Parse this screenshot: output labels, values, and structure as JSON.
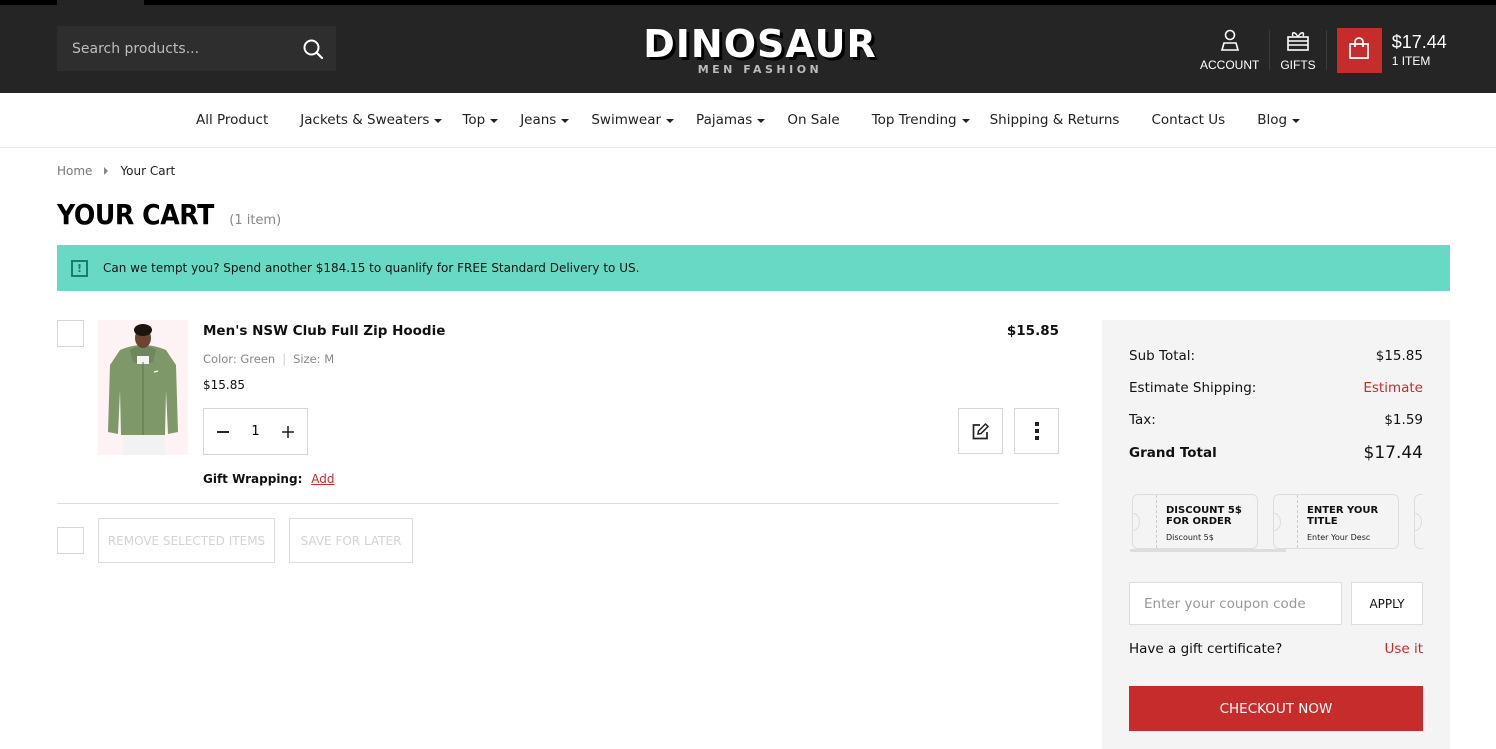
{
  "header": {
    "search_placeholder": "Search products...",
    "logo_brand": "DINOSAUR",
    "logo_tagline": "MEN FASHION",
    "account_label": "ACCOUNT",
    "gifts_label": "GIFTS",
    "cart_total": "$17.44",
    "cart_count": "1 ITEM"
  },
  "nav": {
    "items": [
      {
        "label": "All Product",
        "dropdown": false
      },
      {
        "label": "Jackets & Sweaters",
        "dropdown": true
      },
      {
        "label": "Top",
        "dropdown": true
      },
      {
        "label": "Jeans",
        "dropdown": true
      },
      {
        "label": "Swimwear",
        "dropdown": true
      },
      {
        "label": "Pajamas",
        "dropdown": true
      },
      {
        "label": "On Sale",
        "dropdown": false
      },
      {
        "label": "Top Trending",
        "dropdown": true
      },
      {
        "label": "Shipping & Returns",
        "dropdown": false
      },
      {
        "label": "Contact Us",
        "dropdown": false
      },
      {
        "label": "Blog",
        "dropdown": true
      }
    ]
  },
  "breadcrumb": {
    "home": "Home",
    "current": "Your Cart"
  },
  "page": {
    "title": "YOUR CART",
    "item_count": "(1 item)",
    "alert_icon": "!",
    "alert_text": "Can we tempt you? Spend another $184.15 to quanlify for FREE Standard Delivery to US."
  },
  "cart_item": {
    "name": "Men's NSW Club Full Zip Hoodie",
    "color_label": "Color:",
    "color_value": "Green",
    "size_label": "Size:",
    "size_value": "M",
    "unit_price": "$15.85",
    "line_total": "$15.85",
    "quantity": "1",
    "gift_wrapping_label": "Gift Wrapping:",
    "gift_wrapping_action": "Add",
    "selected": false
  },
  "actions": {
    "remove_selected": "REMOVE SELECTED ITEMS",
    "save_for_later": "SAVE FOR LATER"
  },
  "summary": {
    "subtotal_label": "Sub Total:",
    "subtotal_value": "$15.85",
    "shipping_label": "Estimate Shipping:",
    "shipping_value": "Estimate",
    "tax_label": "Tax:",
    "tax_value": "$1.59",
    "grand_label": "Grand Total",
    "grand_value": "$17.44",
    "coupons": [
      {
        "title": "DISCOUNT 5$ FOR ORDER",
        "desc": "Discount 5$"
      },
      {
        "title": "ENTER YOUR TITLE",
        "desc": "Enter Your Desc"
      },
      {
        "title": "",
        "desc": ""
      }
    ],
    "coupon_placeholder": "Enter your coupon code",
    "apply_label": "APPLY",
    "gift_cert_text": "Have a gift certificate?",
    "gift_cert_action": "Use it",
    "checkout_label": "CHECKOUT NOW"
  },
  "colors": {
    "brand_red": "#c62c2c",
    "header_bg": "#252525",
    "alert_bg": "#67d9c4",
    "summary_bg": "#f4f4f4"
  }
}
